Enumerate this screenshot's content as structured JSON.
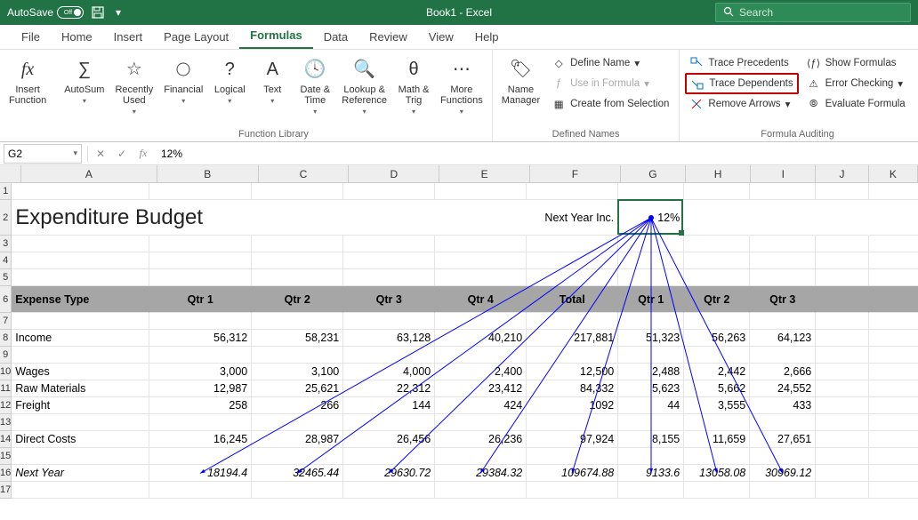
{
  "titlebar": {
    "autosave": "AutoSave",
    "toggle": "Off",
    "title": "Book1  -  Excel",
    "search_ph": "Search"
  },
  "tabs": [
    "File",
    "Home",
    "Insert",
    "Page Layout",
    "Formulas",
    "Data",
    "Review",
    "View",
    "Help"
  ],
  "tabs_active": 4,
  "ribbon": {
    "insert_fn": "Insert\nFunction",
    "autosum": "AutoSum",
    "recent": "Recently\nUsed",
    "financial": "Financial",
    "logical": "Logical",
    "text": "Text",
    "datetime": "Date &\nTime",
    "lookup": "Lookup &\nReference",
    "math": "Math &\nTrig",
    "more": "More\nFunctions",
    "grp_lib": "Function Library",
    "name_mgr": "Name\nManager",
    "def_name": "Define Name",
    "use_in": "Use in Formula",
    "create_sel": "Create from Selection",
    "grp_names": "Defined Names",
    "trace_prec": "Trace Precedents",
    "trace_dep": "Trace Dependents",
    "remove_arr": "Remove Arrows",
    "show_form": "Show Formulas",
    "err_check": "Error Checking",
    "eval_form": "Evaluate Formula",
    "grp_audit": "Formula Auditing"
  },
  "namebox": "G2",
  "formula": "12%",
  "colheaders": [
    "A",
    "B",
    "C",
    "D",
    "E",
    "F",
    "G",
    "H",
    "I",
    "J",
    "K"
  ],
  "rows": {
    "title": "Expenditure Budget",
    "next_year_inc_lbl": "Next Year Inc.",
    "g2": "12%",
    "hdr": [
      "Expense Type",
      "Qtr 1",
      "Qtr 2",
      "Qtr 3",
      "Qtr 4",
      "Total",
      "Qtr 1",
      "Qtr 2",
      "Qtr 3"
    ],
    "r8": [
      "Income",
      "56,312",
      "58,231",
      "63,128",
      "40,210",
      "217,881",
      "51,323",
      "56,263",
      "64,123"
    ],
    "r10": [
      "Wages",
      "3,000",
      "3,100",
      "4,000",
      "2,400",
      "12,500",
      "2,488",
      "2,442",
      "2,666"
    ],
    "r11": [
      "Raw Materials",
      "12,987",
      "25,621",
      "22,312",
      "23,412",
      "84,332",
      "5,623",
      "5,662",
      "24,552"
    ],
    "r12": [
      "Freight",
      "258",
      "266",
      "144",
      "424",
      "1092",
      "44",
      "3,555",
      "433"
    ],
    "r14": [
      "Direct Costs",
      "16,245",
      "28,987",
      "26,456",
      "26,236",
      "97,924",
      "8,155",
      "11,659",
      "27,651"
    ],
    "r16": [
      "Next Year",
      "18194.4",
      "32465.44",
      "29630.72",
      "29384.32",
      "109674.88",
      "9133.6",
      "13058.08",
      "30969.12"
    ]
  }
}
